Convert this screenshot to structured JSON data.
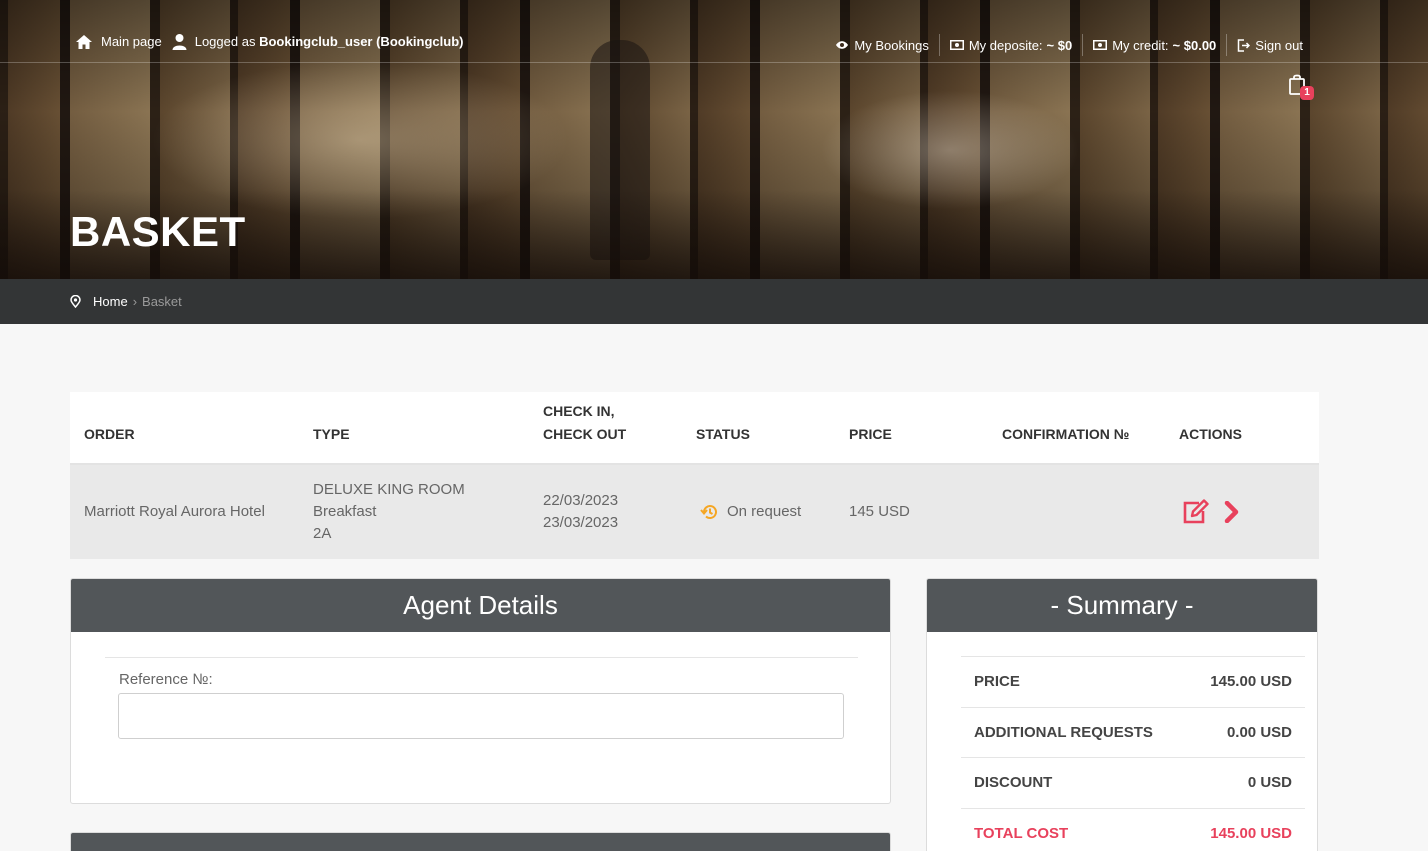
{
  "topnav": {
    "main_page": "Main page",
    "logged_as_prefix": "Logged as",
    "logged_as_user": "Bookingclub_user (Bookingclub)",
    "my_bookings": "My Bookings",
    "my_deposite_label": "My deposite:",
    "my_deposite_value": "~ $0",
    "my_credit_label": "My credit:",
    "my_credit_value": "~ $0.00",
    "sign_out": "Sign out",
    "cart_count": "1"
  },
  "page": {
    "title": "BASKET"
  },
  "breadcrumb": {
    "home": "Home",
    "separator": "›",
    "current": "Basket"
  },
  "table": {
    "headers": {
      "order": "ORDER",
      "type": "TYPE",
      "checkin_1": "CHECK IN,",
      "checkin_2": "CHECK OUT",
      "status": "STATUS",
      "price": "PRICE",
      "confirmation": "CONFIRMATION №",
      "actions": "ACTIONS"
    },
    "rows": [
      {
        "order": "Marriott Royal Aurora Hotel",
        "type_1": "DELUXE KING ROOM",
        "type_2": "Breakfast",
        "type_3": "2A",
        "checkin": "22/03/2023",
        "checkout": "23/03/2023",
        "status": "On request",
        "price": "145 USD",
        "confirmation": ""
      }
    ]
  },
  "agent": {
    "title": "Agent Details",
    "reference_label": "Reference №:",
    "reference_value": ""
  },
  "summary": {
    "title": "- Summary -",
    "rows": [
      {
        "label": "PRICE",
        "value": "145.00 USD"
      },
      {
        "label": "ADDITIONAL REQUESTS",
        "value": "0.00 USD"
      },
      {
        "label": "DISCOUNT",
        "value": "0 USD"
      },
      {
        "label": "TOTAL COST",
        "value": "145.00 USD"
      }
    ]
  },
  "colors": {
    "accent": "#e8415c",
    "status_icon": "#f5a623",
    "panel_header": "#525659",
    "breadcrumb_bar": "#333536"
  },
  "icons": {
    "main_page": "home-icon",
    "logged_as": "user-icon",
    "my_bookings": "eye-icon",
    "deposite": "money-icon",
    "credit": "money-icon",
    "sign_out": "sign-out-icon",
    "cart": "shopping-bag-icon",
    "breadcrumb": "map-pin-icon",
    "status": "history-icon",
    "edit": "edit-icon",
    "proceed": "chevron-right-icon"
  }
}
